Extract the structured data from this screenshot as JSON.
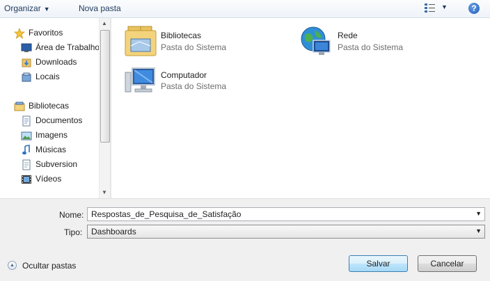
{
  "toolbar": {
    "organize_label": "Organizar",
    "new_folder_label": "Nova pasta",
    "help_label": "?"
  },
  "nav": {
    "favorites_label": "Favoritos",
    "favorites_items": [
      "Área de Trabalho",
      "Downloads",
      "Locais"
    ],
    "libraries_label": "Bibliotecas",
    "libraries_items": [
      "Documentos",
      "Imagens",
      "Músicas",
      "Subversion",
      "Vídeos"
    ]
  },
  "main": {
    "tiles": [
      {
        "title": "Bibliotecas",
        "subtitle": "Pasta do Sistema"
      },
      {
        "title": "Rede",
        "subtitle": "Pasta do Sistema"
      },
      {
        "title": "Computador",
        "subtitle": "Pasta do Sistema"
      }
    ]
  },
  "form": {
    "name_label": "Nome:",
    "name_value": "Respostas_de_Pesquisa_de_Satisfação",
    "type_label": "Tipo:",
    "type_value": "Dashboards"
  },
  "footer": {
    "hide_folders_label": "Ocultar pastas",
    "save_label": "Salvar",
    "cancel_label": "Cancelar"
  }
}
